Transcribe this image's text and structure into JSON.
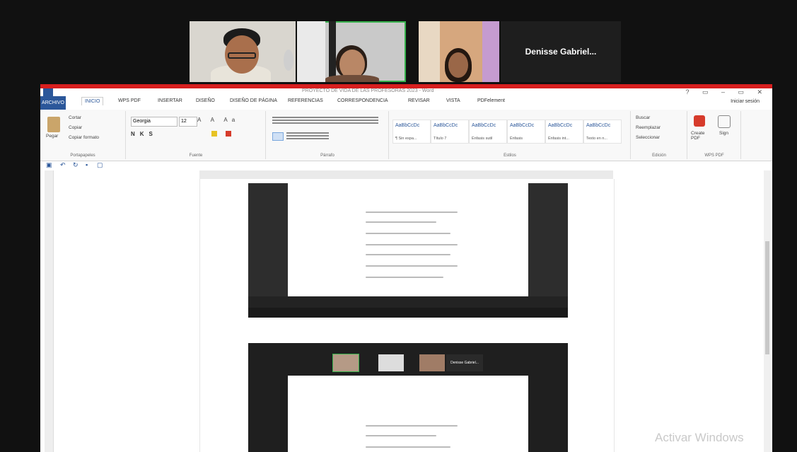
{
  "participants": [
    {
      "kind": "video"
    },
    {
      "kind": "video",
      "active": true
    },
    {
      "kind": "video"
    },
    {
      "kind": "name",
      "label": "Denisse Gabriel..."
    }
  ],
  "word": {
    "title": "PROYECTO DE VIDA DE LAS PROFESORAS 2023 - Word",
    "window_controls": "? ▭ – ▭ ✕",
    "tabs": [
      "ARCHIVO",
      "INICIO",
      "WPS PDF",
      "INSERTAR",
      "DISEÑO",
      "DISEÑO DE PÁGINA",
      "REFERENCIAS",
      "CORRESPONDENCIA",
      "REVISAR",
      "VISTA",
      "PDFelement"
    ],
    "signin": "Iniciar sesión",
    "ribbon": {
      "clipboard": {
        "paste": "Pegar",
        "cut": "Cortar",
        "copy": "Copiar",
        "format": "Copiar formato",
        "label": "Portapapeles"
      },
      "font": {
        "name": "Georgia",
        "size": "12",
        "label": "Fuente"
      },
      "paragraph": {
        "label": "Párrafo"
      },
      "styles": {
        "label": "Estilos",
        "items": [
          {
            "sample": "AaBbCcDc",
            "name": "¶ Sin espa..."
          },
          {
            "sample": "AaBbCcDc",
            "name": "Título 7"
          },
          {
            "sample": "AaBbCcDc",
            "name": "Énfasis sutil"
          },
          {
            "sample": "AaBbCcDc",
            "name": "Énfasis"
          },
          {
            "sample": "AaBbCcDc",
            "name": "Énfasis int..."
          },
          {
            "sample": "AaBbCcDc",
            "name": "Texto en n..."
          }
        ]
      },
      "editing": {
        "find": "Buscar",
        "replace": "Reemplazar",
        "select": "Seleccionar",
        "label": "Edición"
      },
      "wps": {
        "create": "Create PDF",
        "sign": "Sign",
        "label": "WPS PDF"
      }
    },
    "inner_meeting_name": "Denisse Gabriel...",
    "watermark": "Activar Windows"
  }
}
